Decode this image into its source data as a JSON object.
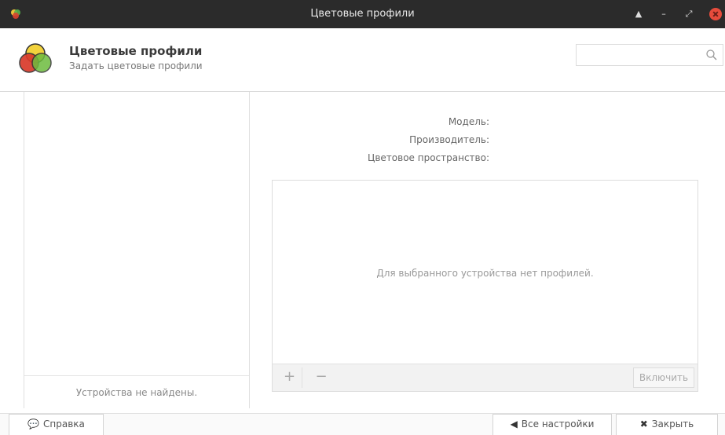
{
  "window": {
    "title": "Цветовые профили"
  },
  "header": {
    "title": "Цветовые профили",
    "subtitle": "Задать цветовые профили",
    "search_placeholder": ""
  },
  "devices": {
    "empty_text": "Устройства не найдены."
  },
  "properties": {
    "model_label": "Модель:",
    "manufacturer_label": "Производитель:",
    "colorspace_label": "Цветовое пространство:"
  },
  "profiles": {
    "empty_text": "Для выбранного устройства нет профилей.",
    "add_label": "+",
    "remove_label": "−",
    "enable_label": "Включить"
  },
  "footer": {
    "help_label": "Справка",
    "all_settings_label": "Все настройки",
    "close_label": "Закрыть"
  },
  "colors": {
    "titlebar": "#2b2b2b",
    "close": "#e74c3c"
  }
}
